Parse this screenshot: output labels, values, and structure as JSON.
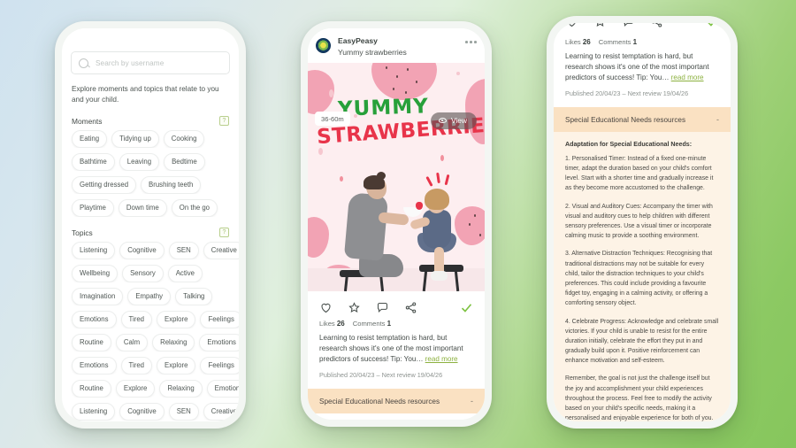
{
  "background": {
    "from": "#cfe2ef",
    "to": "#86c65c"
  },
  "accent": {
    "green": "#8cb13f",
    "red": "#e8344a",
    "title_green": "#27a03a",
    "sen_banner": "#fae1c2",
    "sen_panel": "#fdf3e6"
  },
  "left_phone": {
    "search": {
      "placeholder": "Search by username"
    },
    "intro": "Explore moments and topics that relate to you and your child.",
    "sections": [
      {
        "title": "Moments",
        "help": "?",
        "rows": [
          [
            "Eating",
            "Tidying up",
            "Cooking"
          ],
          [
            "Bathtime",
            "Leaving",
            "Bedtime"
          ],
          [
            "Getting dressed",
            "Brushing teeth"
          ],
          [
            "Playtime",
            "Down time",
            "On the go"
          ]
        ]
      },
      {
        "title": "Topics",
        "help": "?",
        "rows": [
          [
            "Listening",
            "Cognitive",
            "SEN",
            "Creative"
          ],
          [
            "Wellbeing",
            "Sensory",
            "Active"
          ],
          [
            "Imagination",
            "Empathy",
            "Talking"
          ],
          [
            "Emotions",
            "Tired",
            "Explore",
            "Feelings"
          ],
          [
            "Routine",
            "Calm",
            "Relaxing",
            "Emotions"
          ],
          [
            "Emotions",
            "Tired",
            "Explore",
            "Feelings"
          ],
          [
            "Routine",
            "Explore",
            "Relaxing",
            "Emotions"
          ],
          [
            "Listening",
            "Cognitive",
            "SEN",
            "Creative"
          ]
        ]
      }
    ]
  },
  "middle_phone": {
    "brand": "EasyPeasy",
    "subtitle": "Yummy strawberries",
    "more_menu": "more-options",
    "duration_badge": "36-60m",
    "view_button": "View",
    "hero_title_line1": "YUMMY",
    "hero_title_line2": "STRAWBERRIES",
    "actions": [
      "like-heart",
      "favourite-star",
      "comment-bubble",
      "share",
      "done-check"
    ],
    "likes_label": "Likes",
    "likes_count": "26",
    "comments_label": "Comments",
    "comments_count": "1",
    "body": "Learning to resist temptation is hard, but research shows it's one of the most important predictors of success! Tip: You…",
    "read_more": "read more",
    "published": "Published 20/04/23 – Next review 19/04/26",
    "sen_banner": "Special Educational Needs resources",
    "sen_toggle": "-"
  },
  "right_phone": {
    "likes_label": "Likes",
    "likes_count": "26",
    "comments_label": "Comments",
    "comments_count": "1",
    "body": "Learning to resist temptation is hard, but research shows it's one of the most important predictors of success! Tip: You…",
    "read_more": "read more",
    "published": "Published 20/04/23 – Next review 19/04/26",
    "sen_banner": "Special Educational Needs resources",
    "sen_toggle": "-",
    "sen_heading": "Adaptation for Special Educational Needs:",
    "sen_paragraphs": [
      "1. Personalised Timer: Instead of a fixed one-minute timer, adapt the duration based on your child's comfort level. Start with a shorter time and gradually increase it as they become more accustomed to the challenge.",
      "2. Visual and Auditory Cues: Accompany the timer with visual and auditory cues to help children with different sensory preferences. Use a visual timer or incorporate calming music to provide a soothing environment.",
      "3. Alternative Distraction Techniques: Recognising that traditional distractions may not be suitable for every child, tailor the distraction techniques to your child's preferences. This could include providing a favourite fidget toy, engaging in a calming activity, or offering a comforting sensory object.",
      "4. Celebrate Progress: Acknowledge and celebrate small victories. If your child is unable to resist for the entire duration initially, celebrate the effort they put in and gradually build upon it. Positive reinforcement can enhance motivation and self-esteem.",
      "Remember, the goal is not just the challenge itself but the joy and accomplishment your child experiences throughout the process. Feel free to modify the activity based on your child's specific needs, making it a personalised and enjoyable experience for both of you."
    ]
  }
}
